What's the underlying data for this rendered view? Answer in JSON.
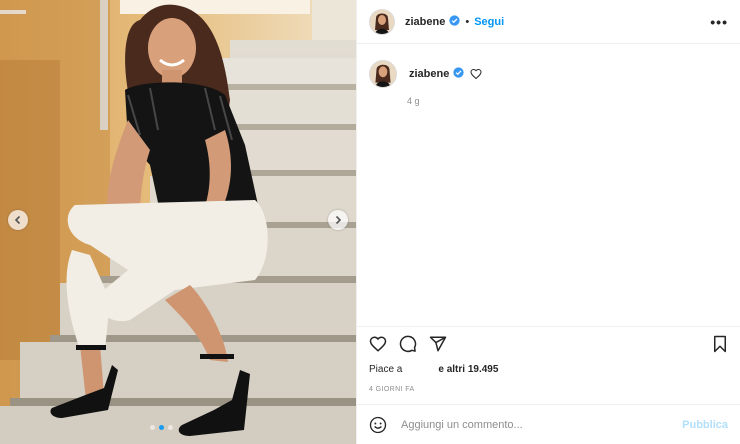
{
  "header": {
    "username": "ziabene",
    "separator": "•",
    "follow_label": "Segui",
    "more_label": "•••"
  },
  "caption": {
    "username": "ziabene",
    "time_ago": "4 g"
  },
  "likes": {
    "prefix": "Piace a",
    "suffix": "e altri 19.495"
  },
  "date_label": "4 GIORNI FA",
  "comment": {
    "placeholder": "Aggiungi un commento...",
    "publish_label": "Pubblica"
  },
  "carousel": {
    "dot_count": 3,
    "active_index": 1
  },
  "colors": {
    "accent": "#0095f6",
    "verified": "#3897f0",
    "publish_disabled": "#b2dffc"
  }
}
